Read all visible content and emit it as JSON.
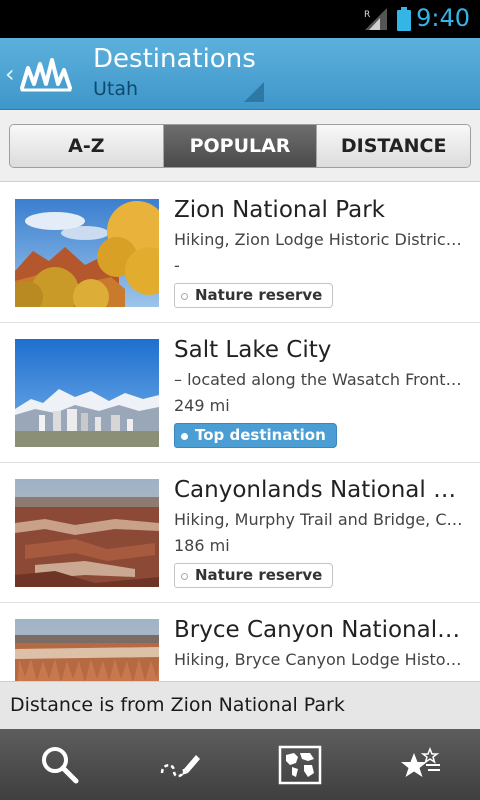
{
  "status_bar": {
    "time": "9:40",
    "icons": [
      "signal-icon",
      "battery-icon"
    ]
  },
  "header": {
    "title": "Destinations",
    "subtitle": "Utah",
    "icons": [
      "back-chevron-icon",
      "app-logo-icon",
      "dropdown-corner-icon"
    ]
  },
  "tabs": [
    {
      "label": "A-Z",
      "active": false
    },
    {
      "label": "POPULAR",
      "active": true
    },
    {
      "label": "DISTANCE",
      "active": false
    }
  ],
  "destinations": [
    {
      "name": "Zion National Park",
      "description": "Hiking, Zion Lodge Historic District, …",
      "distance": "-",
      "tag": "Nature reserve",
      "tag_style": "plain"
    },
    {
      "name": "Salt Lake City",
      "description": "– located along the Wasatch Front, …",
      "distance": "249 mi",
      "tag": "Top destination",
      "tag_style": "highlight"
    },
    {
      "name": "Canyonlands National Park",
      "description": "Hiking, Murphy Trail and Bridge, C…",
      "distance": "186 mi",
      "tag": "Nature reserve",
      "tag_style": "plain"
    },
    {
      "name": "Bryce Canyon National Park",
      "description": "Hiking, Bryce Canyon Lodge Histori…",
      "distance": "",
      "tag": "",
      "tag_style": "plain"
    }
  ],
  "notice": "Distance is from Zion National Park",
  "bottom_bar": [
    "search-icon",
    "draw-route-icon",
    "world-map-icon",
    "favorites-stars-icon"
  ],
  "colors": {
    "accent": "#4b9ed4",
    "header": "#4aa3d3",
    "status_time": "#33b5e5"
  }
}
